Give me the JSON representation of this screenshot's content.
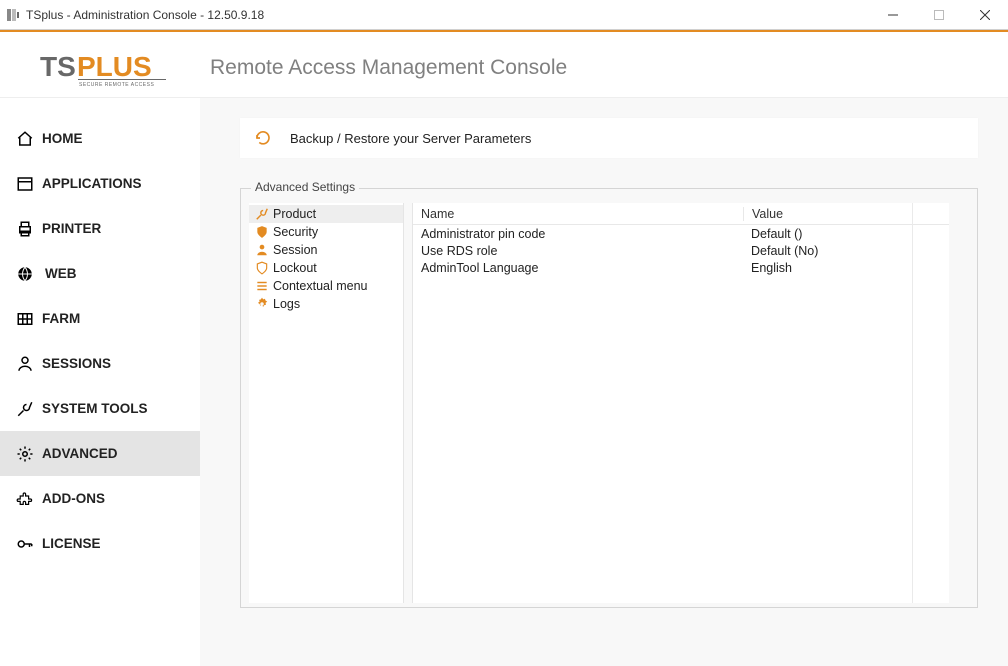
{
  "window": {
    "title": "TSplus - Administration Console - 12.50.9.18"
  },
  "header": {
    "logo_text": "TSPLUS",
    "logo_sub": "SECURE REMOTE ACCESS",
    "app_title": "Remote Access Management Console"
  },
  "sidebar": {
    "items": [
      {
        "id": "home",
        "label": "HOME"
      },
      {
        "id": "applications",
        "label": "APPLICATIONS"
      },
      {
        "id": "printer",
        "label": "PRINTER"
      },
      {
        "id": "web",
        "label": "WEB"
      },
      {
        "id": "farm",
        "label": "FARM"
      },
      {
        "id": "sessions",
        "label": "SESSIONS"
      },
      {
        "id": "system-tools",
        "label": "SYSTEM TOOLS"
      },
      {
        "id": "advanced",
        "label": "ADVANCED",
        "active": true
      },
      {
        "id": "add-ons",
        "label": "ADD-ONS"
      },
      {
        "id": "license",
        "label": "LICENSE"
      }
    ]
  },
  "content": {
    "backup_label": "Backup / Restore your Server Parameters",
    "advanced_legend": "Advanced Settings",
    "categories": [
      {
        "id": "product",
        "label": "Product",
        "selected": true
      },
      {
        "id": "security",
        "label": "Security"
      },
      {
        "id": "session",
        "label": "Session"
      },
      {
        "id": "lockout",
        "label": "Lockout"
      },
      {
        "id": "contextual-menu",
        "label": "Contextual menu"
      },
      {
        "id": "logs",
        "label": "Logs"
      }
    ],
    "columns": {
      "name": "Name",
      "value": "Value"
    },
    "rows": [
      {
        "name": "Administrator pin code",
        "value": "Default ()"
      },
      {
        "name": "Use RDS role",
        "value": "Default (No)"
      },
      {
        "name": "AdminTool Language",
        "value": "English"
      }
    ]
  }
}
